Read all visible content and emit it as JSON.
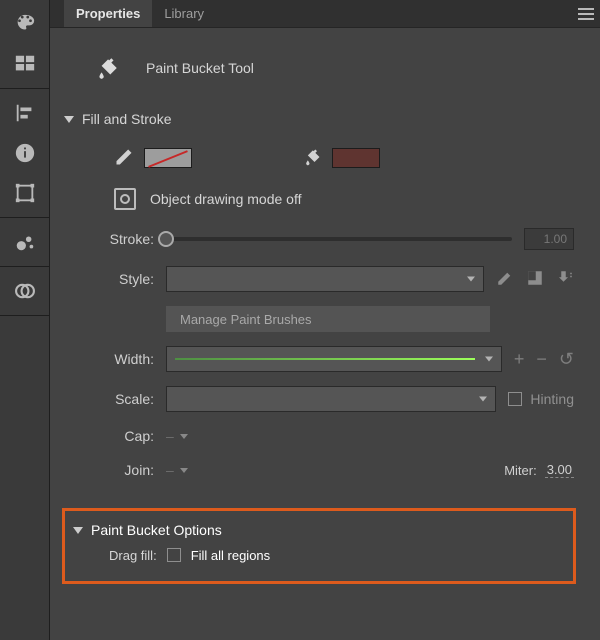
{
  "tabs": {
    "properties": "Properties",
    "library": "Library"
  },
  "tool": {
    "name": "Paint Bucket Tool"
  },
  "fillstroke": {
    "title": "Fill and Stroke",
    "mode": "Object drawing mode off",
    "stroke_label": "Stroke:",
    "stroke_value": "1.00",
    "style_label": "Style:",
    "manage_brushes": "Manage Paint Brushes",
    "width_label": "Width:",
    "scale_label": "Scale:",
    "hinting_label": "Hinting",
    "cap_label": "Cap:",
    "join_label": "Join:",
    "miter_label": "Miter:",
    "miter_value": "3.00"
  },
  "pbo": {
    "title": "Paint Bucket Options",
    "dragfill_label": "Drag fill:",
    "dragfill_option": "Fill all regions"
  }
}
